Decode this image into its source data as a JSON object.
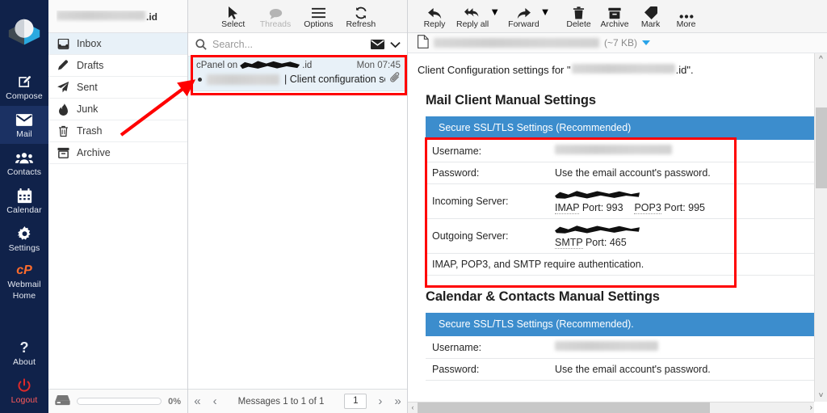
{
  "taskbar": {
    "logo_name": "roundcube-elastic-logo",
    "items": [
      {
        "id": "compose",
        "label": "Compose",
        "icon": "compose-pencil-icon",
        "active": false
      },
      {
        "id": "mail",
        "label": "Mail",
        "icon": "envelope-icon",
        "active": true
      },
      {
        "id": "contacts",
        "label": "Contacts",
        "icon": "contacts-group-icon",
        "active": false
      },
      {
        "id": "calendar",
        "label": "Calendar",
        "icon": "calendar-icon",
        "active": false
      },
      {
        "id": "settings",
        "label": "Settings",
        "icon": "gear-icon",
        "active": false
      },
      {
        "id": "webmail-home",
        "label_line1": "Webmail",
        "label_line2": "Home",
        "icon": "cpanel-logo-icon",
        "active": false
      }
    ],
    "bottom_items": [
      {
        "id": "about",
        "label": "About",
        "icon": "question-mark-icon"
      },
      {
        "id": "logout",
        "label": "Logout",
        "icon": "power-icon"
      }
    ],
    "accent_bg": "#10224a",
    "accent_active_bg": "#1b3163",
    "cpanel_orange": "#ff6c2c",
    "logout_red": "#ff5a5a"
  },
  "folders": {
    "account_name_redacted": true,
    "account_tld": ".id",
    "menu_icon": "kebab-menu-icon",
    "items": [
      {
        "label": "Inbox",
        "icon": "inbox-icon",
        "selected": true
      },
      {
        "label": "Drafts",
        "icon": "pencil-icon",
        "selected": false
      },
      {
        "label": "Sent",
        "icon": "paper-plane-icon",
        "selected": false
      },
      {
        "label": "Junk",
        "icon": "fire-icon",
        "selected": false
      },
      {
        "label": "Trash",
        "icon": "trash-icon",
        "selected": false
      },
      {
        "label": "Archive",
        "icon": "archive-box-icon",
        "selected": false
      }
    ],
    "footer": {
      "disk_icon": "disk-drive-icon",
      "quota_percent": "0%",
      "quota_fill": 0
    }
  },
  "list": {
    "toolbar": [
      {
        "label": "Select",
        "icon": "cursor-arrow-icon",
        "disabled": false
      },
      {
        "label": "Threads",
        "icon": "speech-bubble-icon",
        "disabled": true
      },
      {
        "label": "Options",
        "icon": "sliders-icon",
        "disabled": false
      },
      {
        "label": "Refresh",
        "icon": "refresh-icon",
        "disabled": false
      }
    ],
    "search": {
      "placeholder": "Search...",
      "value": "",
      "icon": "search-icon",
      "scope_icon": "envelope-icon",
      "chevron_icon": "chevron-down-icon"
    },
    "messages": [
      {
        "from_prefix": "cPanel on ",
        "from_redacted": true,
        "from_suffix": ".id",
        "date": "Mon 07:45",
        "unread": true,
        "recipient_redacted": true,
        "separator": "|",
        "subject": "Client configuration setting…",
        "has_attachment": true,
        "attachment_icon": "paperclip-icon",
        "selected": true
      }
    ],
    "footer": {
      "first_page_icon": "double-chevron-left-icon",
      "prev_page_icon": "chevron-left-icon",
      "status": "Messages 1 to 1 of 1",
      "page_value": "1",
      "next_page_icon": "chevron-right-icon",
      "last_page_icon": "double-chevron-right-icon"
    }
  },
  "view": {
    "toolbar": [
      {
        "label": "Reply",
        "icon": "reply-arrow-icon",
        "has_caret": false
      },
      {
        "label": "Reply all",
        "icon": "reply-all-arrow-icon",
        "has_caret": true
      },
      {
        "label": "Forward",
        "icon": "forward-arrow-icon",
        "has_caret": true
      },
      {
        "label": "Delete",
        "icon": "trash-icon",
        "has_caret": false
      },
      {
        "label": "Archive",
        "icon": "archive-box-icon",
        "has_caret": false
      },
      {
        "label": "Mark",
        "icon": "tag-icon",
        "has_caret": false
      },
      {
        "label": "More",
        "icon": "ellipsis-icon",
        "has_caret": false
      }
    ],
    "header": {
      "doc_icon": "document-icon",
      "subject_redacted": true,
      "size": "(~7 KB)",
      "expand_icon": "triangle-down-icon"
    },
    "body": {
      "intro_prefix": "Client Configuration settings for \"",
      "intro_redacted": true,
      "intro_suffix": ".id\".",
      "sections": [
        {
          "id": "mail-client-manual-settings",
          "title": "Mail Client Manual Settings",
          "banner": "Secure SSL/TLS Settings (Recommended)",
          "banner_color": "#3c8dcd",
          "rows": [
            {
              "label": "Username:",
              "type": "redacted"
            },
            {
              "label": "Password:",
              "type": "text",
              "value": "Use the email account's password."
            },
            {
              "label": "Incoming Server:",
              "type": "server",
              "server_redacted": true,
              "ports": [
                {
                  "proto": "IMAP",
                  "text": " Port: 993"
                },
                {
                  "proto": "POP3",
                  "text": " Port: 995"
                }
              ]
            },
            {
              "label": "Outgoing Server:",
              "type": "server",
              "server_redacted": true,
              "ports": [
                {
                  "proto": "SMTP",
                  "text": " Port: 465"
                }
              ]
            }
          ],
          "note": "IMAP, POP3, and SMTP require authentication."
        },
        {
          "id": "calendar-contacts-manual-settings",
          "title": "Calendar & Contacts Manual Settings",
          "banner": "Secure SSL/TLS Settings (Recommended).",
          "banner_color": "#3c8dcd",
          "rows": [
            {
              "label": "Username:",
              "type": "redacted"
            },
            {
              "label": "Password:",
              "type": "text",
              "value": "Use the email account's password."
            }
          ],
          "note": ""
        }
      ]
    },
    "scrollbars": {
      "vertical_up_icon": "chevron-up-icon",
      "vertical_down_icon": "chevron-down-icon",
      "horizontal_right_icon": "chevron-right-icon",
      "horizontal_left_icon": "chevron-left-icon"
    }
  },
  "annotations": {
    "color": "#ff0000",
    "boxes": [
      {
        "name": "message-row-highlight"
      },
      {
        "name": "mail-settings-highlight"
      }
    ],
    "arrow": {
      "name": "pointer-arrow-to-message"
    }
  }
}
